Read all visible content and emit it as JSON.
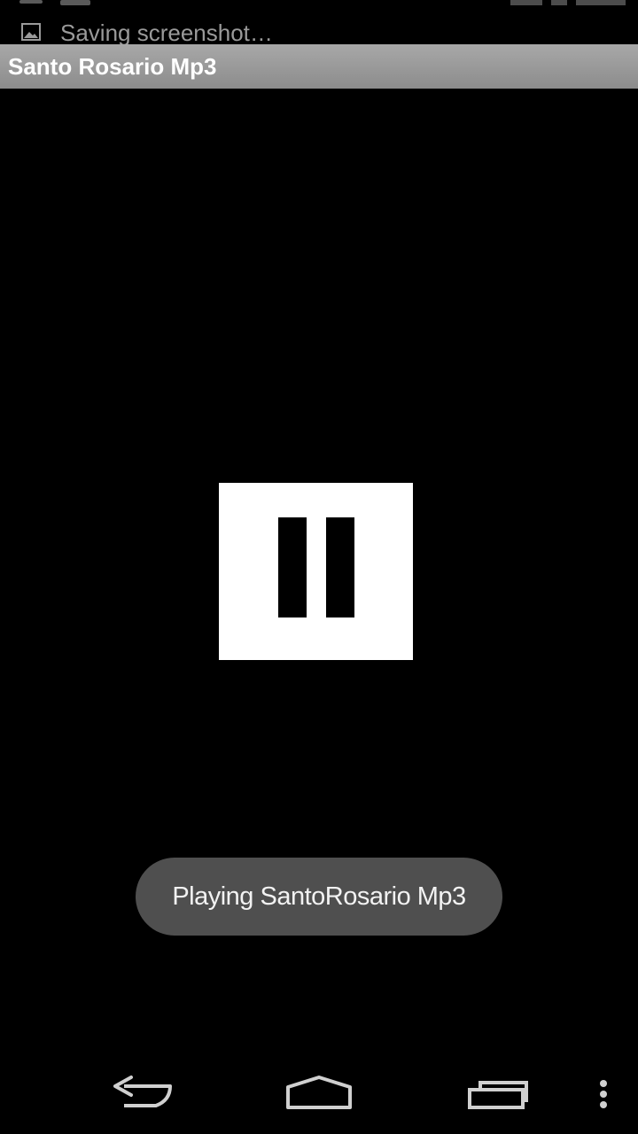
{
  "status_bar": {
    "notification_icon": "image-icon",
    "notification_text": "Saving screenshot…"
  },
  "title_bar": {
    "title": "Santo Rosario Mp3"
  },
  "player": {
    "control_icon": "pause-icon",
    "button_color": "#ffffff"
  },
  "toast": {
    "message": "Playing SantoRosario Mp3"
  },
  "nav_bar": {
    "back_icon": "back-arrow-icon",
    "home_icon": "home-icon",
    "recents_icon": "recents-icon",
    "menu_icon": "overflow-menu-icon"
  },
  "colors": {
    "background": "#000000",
    "title_bar": "#9a9a9a",
    "toast_background": "#4f4f4f",
    "nav_icons": "#d0d0d0"
  }
}
